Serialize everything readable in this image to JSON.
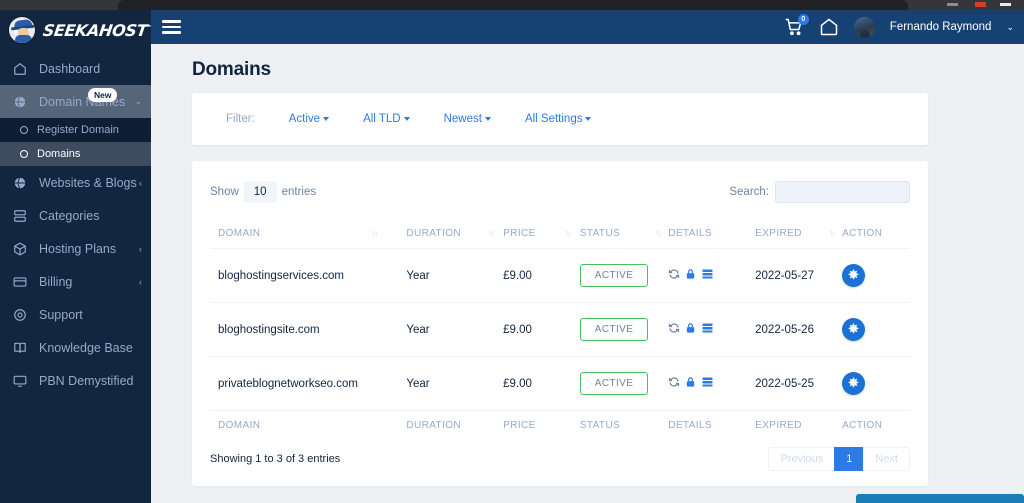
{
  "browser": {
    "window_buttons": [
      "minimize",
      "maximize",
      "close"
    ]
  },
  "brand": {
    "name": "SEEKAHOST",
    "trademark": "™",
    "logo_icon": "wizard-mascot-icon"
  },
  "sidebar": {
    "items": [
      {
        "label": "Dashboard",
        "icon": "home-icon",
        "caret": "",
        "badge": "",
        "active": false
      },
      {
        "label": "Domain Names",
        "icon": "globe-icon",
        "caret": "⌄",
        "badge": "New",
        "active": true
      },
      {
        "label": "Websites & Blogs",
        "icon": "globe-alt-icon",
        "caret": "‹",
        "badge": "",
        "active": false
      },
      {
        "label": "Categories",
        "icon": "layers-icon",
        "caret": "",
        "badge": "",
        "active": false
      },
      {
        "label": "Hosting Plans",
        "icon": "box-icon",
        "caret": "‹",
        "badge": "",
        "active": false
      },
      {
        "label": "Billing",
        "icon": "credit-card-icon",
        "caret": "‹",
        "badge": "",
        "active": false
      },
      {
        "label": "Support",
        "icon": "lifebuoy-icon",
        "caret": "",
        "badge": "",
        "active": false
      },
      {
        "label": "Knowledge Base",
        "icon": "book-icon",
        "caret": "",
        "badge": "",
        "active": false
      },
      {
        "label": "PBN Demystified",
        "icon": "monitor-icon",
        "caret": "",
        "badge": "",
        "active": false
      }
    ],
    "subitems": [
      {
        "label": "Register Domain",
        "icon": "circle-icon",
        "active": false
      },
      {
        "label": "Domains",
        "icon": "circle-icon",
        "active": true
      }
    ]
  },
  "topbar": {
    "menu_icon": "hamburger-icon",
    "cart_icon": "shopping-cart-icon",
    "cart_count": "0",
    "home_icon": "home-icon",
    "avatar_icon": "user-avatar",
    "user_name": "Fernando Raymond",
    "user_caret": "⌄"
  },
  "page": {
    "title": "Domains"
  },
  "filter": {
    "label": "Filter:",
    "buttons": [
      {
        "label": "Active"
      },
      {
        "label": "All TLD"
      },
      {
        "label": "Newest"
      },
      {
        "label": "All Settings"
      }
    ]
  },
  "table_controls": {
    "show_label": "Show",
    "entries_value": "10",
    "entries_label": "entries",
    "search_label": "Search:",
    "search_value": "",
    "search_placeholder": ""
  },
  "table": {
    "columns": [
      {
        "label": "DOMAIN",
        "sortable": true,
        "sort_icon": "sort-asc-desc-icon"
      },
      {
        "label": "DURATION",
        "sortable": true,
        "sort_icon": "sort-asc-desc-icon"
      },
      {
        "label": "PRICE",
        "sortable": true,
        "sort_icon": "sort-asc-desc-icon"
      },
      {
        "label": "STATUS",
        "sortable": true,
        "sort_icon": "sort-asc-desc-icon"
      },
      {
        "label": "DETAILS",
        "sortable": false,
        "sort_icon": ""
      },
      {
        "label": "EXPIRED",
        "sortable": true,
        "sort_icon": "sort-asc-desc-icon"
      },
      {
        "label": "ACTION",
        "sortable": false,
        "sort_icon": ""
      }
    ],
    "rows": [
      {
        "domain": "bloghostingservices.com",
        "duration": "Year",
        "price": "£9.00",
        "status": "ACTIVE",
        "details_icons": [
          "refresh-icon",
          "lock-icon",
          "server-list-icon"
        ],
        "expired": "2022-05-27",
        "action_icon": "gear-icon"
      },
      {
        "domain": "bloghostingsite.com",
        "duration": "Year",
        "price": "£9.00",
        "status": "ACTIVE",
        "details_icons": [
          "refresh-icon",
          "lock-icon",
          "server-list-icon"
        ],
        "expired": "2022-05-26",
        "action_icon": "gear-icon"
      },
      {
        "domain": "privateblognetworkseo.com",
        "duration": "Year",
        "price": "£9.00",
        "status": "ACTIVE",
        "details_icons": [
          "refresh-icon",
          "lock-icon",
          "server-list-icon"
        ],
        "expired": "2022-05-25",
        "action_icon": "gear-icon"
      }
    ]
  },
  "pagination": {
    "info": "Showing 1 to 3 of 3 entries",
    "previous": "Previous",
    "pages": [
      "1"
    ],
    "next": "Next"
  },
  "colors": {
    "sidebar_bg": "#12263f",
    "topbar_bg": "#164273",
    "accent_blue": "#2c7be5",
    "status_green": "#47c05a",
    "muted_text": "#95aac9",
    "content_bg": "#eef0f3",
    "chat_bar": "#1b7db5"
  }
}
